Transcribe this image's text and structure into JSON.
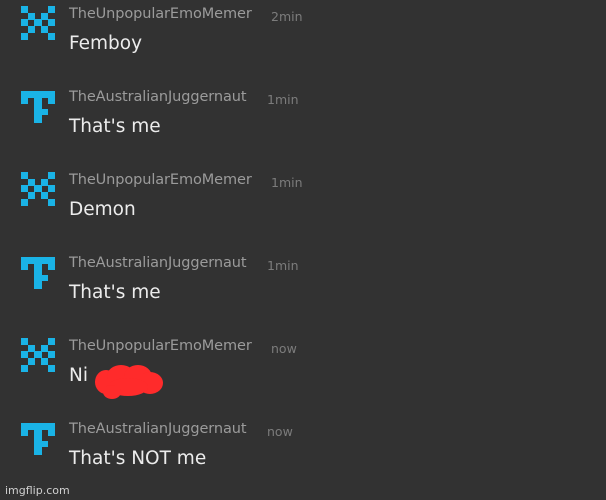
{
  "colors": {
    "background": "#323232",
    "avatar_blue": "#1ab3e6",
    "username": "#9b9b9b",
    "timestamp": "#7c7c7c",
    "message_text": "#ececec",
    "scribble_red": "#ff2b2b"
  },
  "messages": [
    {
      "avatar": "pixel-x-icon",
      "username": "TheUnpopularEmoMemer",
      "time": "2min",
      "text": "Femboy"
    },
    {
      "avatar": "pixel-t-icon",
      "username": "TheAustralianJuggernaut",
      "time": "1min",
      "text": "That's me"
    },
    {
      "avatar": "pixel-x-icon",
      "username": "TheUnpopularEmoMemer",
      "time": "1min",
      "text": "Demon"
    },
    {
      "avatar": "pixel-t-icon",
      "username": "TheAustralianJuggernaut",
      "time": "1min",
      "text": "That's me"
    },
    {
      "avatar": "pixel-x-icon",
      "username": "TheUnpopularEmoMemer",
      "time": "now",
      "text": "Ni"
    },
    {
      "avatar": "pixel-t-icon",
      "username": "TheAustralianJuggernaut",
      "time": "now",
      "text": "That's NOT me"
    }
  ],
  "watermark": "imgflip.com"
}
